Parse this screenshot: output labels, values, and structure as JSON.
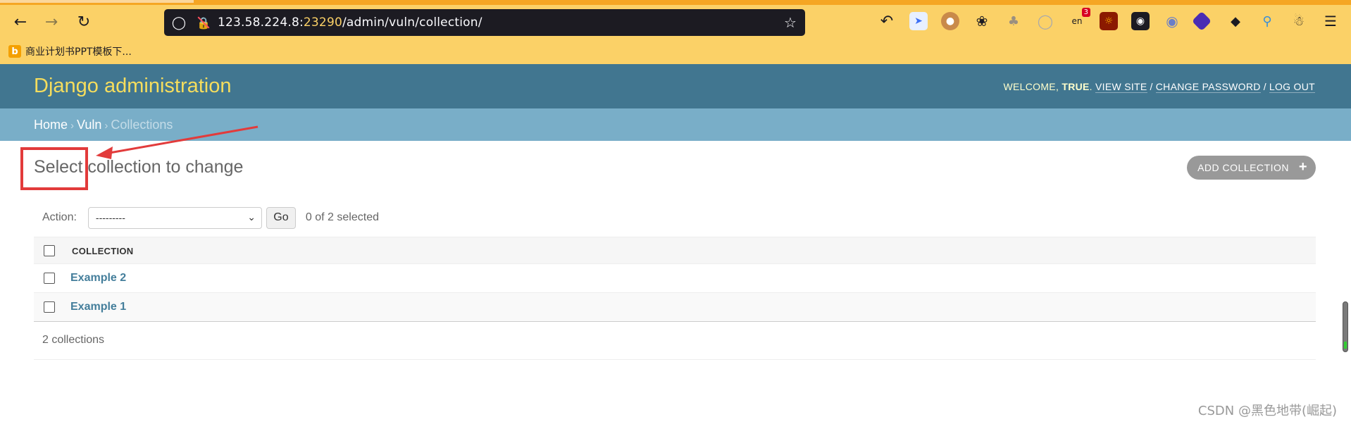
{
  "browser": {
    "url_host": "123.58.224.8:",
    "url_port": "23290",
    "url_path": "/admin/vuln/collection/",
    "bookmark_label": "商业计划书PPT模板下...",
    "extension_badge": "3",
    "extension_badge_sub": "en"
  },
  "header": {
    "branding": "Django administration",
    "welcome": "WELCOME,",
    "username": "TRUE",
    "view_site": "VIEW SITE",
    "change_password": "CHANGE PASSWORD",
    "log_out": "LOG OUT"
  },
  "breadcrumbs": {
    "home": "Home",
    "app": "Vuln",
    "current": "Collections"
  },
  "main": {
    "title": "Select collection to change",
    "add_button": "ADD COLLECTION"
  },
  "actions": {
    "label": "Action:",
    "selected_option": "---------",
    "go_label": "Go",
    "counter": "0 of 2 selected"
  },
  "table": {
    "column_header": "COLLECTION",
    "rows": [
      {
        "label": "Example 2"
      },
      {
        "label": "Example 1"
      }
    ],
    "footer": "2 collections"
  },
  "watermark": "CSDN @黑色地带(崛起)",
  "colors": {
    "browser_chrome": "#fbd167",
    "django_header": "#417690",
    "breadcrumbs": "#79aec8",
    "branding_text": "#f5dd5d",
    "link": "#447e9b",
    "annotation": "#e23b3b"
  }
}
